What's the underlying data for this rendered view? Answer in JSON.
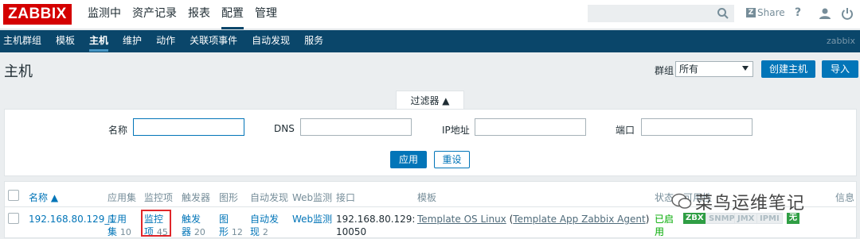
{
  "brand": {
    "logo_text": "ZABBIX",
    "logo_color": "#d40000"
  },
  "main_menu": [
    {
      "label": "监测中"
    },
    {
      "label": "资产记录"
    },
    {
      "label": "报表"
    },
    {
      "label": "配置",
      "active": true
    },
    {
      "label": "管理"
    }
  ],
  "topbar": {
    "share_label": "Share",
    "help_label": "?"
  },
  "sub_menu": [
    {
      "label": "主机群组"
    },
    {
      "label": "模板"
    },
    {
      "label": "主机",
      "active": true
    },
    {
      "label": "维护"
    },
    {
      "label": "动作"
    },
    {
      "label": "关联项事件"
    },
    {
      "label": "自动发现"
    },
    {
      "label": "服务"
    }
  ],
  "sub_right": "zabbix",
  "page": {
    "title": "主机",
    "group_label": "群组",
    "group_value": "所有",
    "create_button": "创建主机",
    "import_button": "导入"
  },
  "filter": {
    "tab_label": "过滤器 ▲",
    "fields": {
      "name_label": "名称",
      "name_value": "",
      "dns_label": "DNS",
      "dns_value": "",
      "ip_label": "IP地址",
      "ip_value": "",
      "port_label": "端口",
      "port_value": ""
    },
    "apply_button": "应用",
    "reset_button": "重设"
  },
  "table": {
    "headers": {
      "name": "名称 ▲",
      "apps": "应用集",
      "items": "监控项",
      "triggers": "触发器",
      "graphs": "图形",
      "discovery": "自动发现",
      "web": "Web监测",
      "interface": "接口",
      "templates": "模板",
      "status": "状态",
      "availability": "可用性",
      "info": "信息"
    },
    "row": {
      "name": "192.168.80.129_1",
      "apps_label_1": "应用",
      "apps_label_2": "集",
      "apps_count": "10",
      "items_label_1": "监控",
      "items_label_2": "项",
      "items_count": "45",
      "triggers_label_1": "触发",
      "triggers_label_2": "器",
      "triggers_count": "20",
      "graphs_label_1": "图",
      "graphs_label_2": "形",
      "graphs_count": "12",
      "discovery_label_1": "自动发",
      "discovery_label_2": "现",
      "discovery_count": "2",
      "web_label": "Web监测",
      "interface_1": "192.168.80.129:",
      "interface_2": "10050",
      "template_main": "Template OS Linux",
      "template_paren_open": " (",
      "template_sub": "Template App Zabbix Agent",
      "template_paren_close": ")",
      "status_1": "已启",
      "status_2": "用",
      "badge_zbx": "ZBX",
      "badge_snmp": "SNMP",
      "badge_jmx": "JMX",
      "badge_ipmi": "IPMI",
      "badge_none": "无"
    }
  },
  "watermark": {
    "text": "菜鸟运维笔记"
  },
  "colors": {
    "accent": "#0275b8",
    "nav": "#0a466a",
    "ok": "#2f9e44"
  }
}
